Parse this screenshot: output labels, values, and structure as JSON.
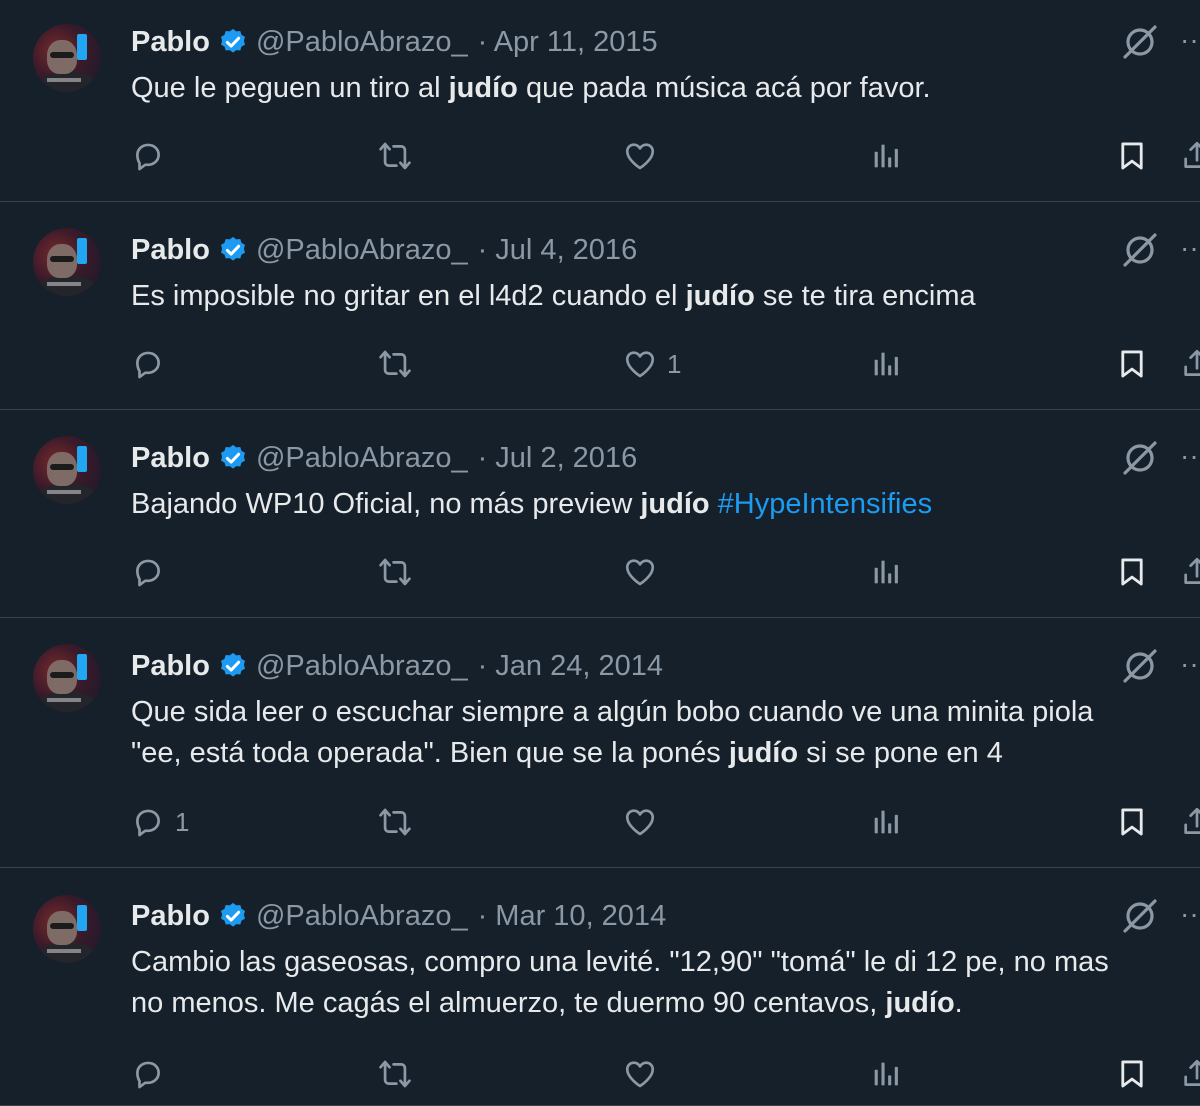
{
  "author": {
    "name": "Pablo",
    "handle": "@PabloAbrazo_",
    "verified": true
  },
  "colors": {
    "background": "#15202b",
    "text": "#e7e9ea",
    "muted": "#8b98a5",
    "accent": "#1d9bf0",
    "divider": "#38444d"
  },
  "icons": {
    "reply": "reply-icon",
    "retweet": "retweet-icon",
    "like": "like-icon",
    "views": "views-icon",
    "bookmark": "bookmark-icon",
    "share": "share-icon",
    "grok": "grok-icon",
    "more": "more-icon",
    "verified": "verified-badge-icon"
  },
  "tweets": [
    {
      "date": "· Apr 11, 2015",
      "segments": [
        {
          "t": "Que le peguen un tiro al "
        },
        {
          "t": "judío",
          "b": true
        },
        {
          "t": " que pada música acá por favor."
        }
      ],
      "reply_count": "",
      "like_count": ""
    },
    {
      "date": "· Jul 4, 2016",
      "segments": [
        {
          "t": "Es imposible no gritar en el l4d2 cuando el "
        },
        {
          "t": "judío",
          "b": true
        },
        {
          "t": " se te tira encima"
        }
      ],
      "reply_count": "",
      "like_count": "1"
    },
    {
      "date": "· Jul 2, 2016",
      "segments": [
        {
          "t": "Bajando WP10 Oficial, no más preview "
        },
        {
          "t": "judío",
          "b": true
        },
        {
          "t": " "
        },
        {
          "t": "#HypeIntensifies",
          "h": true
        }
      ],
      "reply_count": "",
      "like_count": ""
    },
    {
      "date": "· Jan 24, 2014",
      "segments": [
        {
          "t": "Que sida leer o escuchar siempre a algún bobo cuando ve una minita piola"
        },
        {
          "br": true
        },
        {
          "t": "\"ee, está toda operada\". Bien que se la ponés "
        },
        {
          "t": "judío",
          "b": true
        },
        {
          "t": " si se pone en 4"
        }
      ],
      "reply_count": "1",
      "like_count": ""
    },
    {
      "date": "· Mar 10, 2014",
      "segments": [
        {
          "t": "Cambio las gaseosas, compro una levité. \"12,90\" \"tomá\" le di 12 pe, no mas"
        },
        {
          "br": true
        },
        {
          "t": "no menos. Me cagás el almuerzo, te duermo 90 centavos, "
        },
        {
          "t": "judío",
          "b": true
        },
        {
          "t": "."
        }
      ],
      "reply_count": "",
      "like_count": ""
    }
  ]
}
